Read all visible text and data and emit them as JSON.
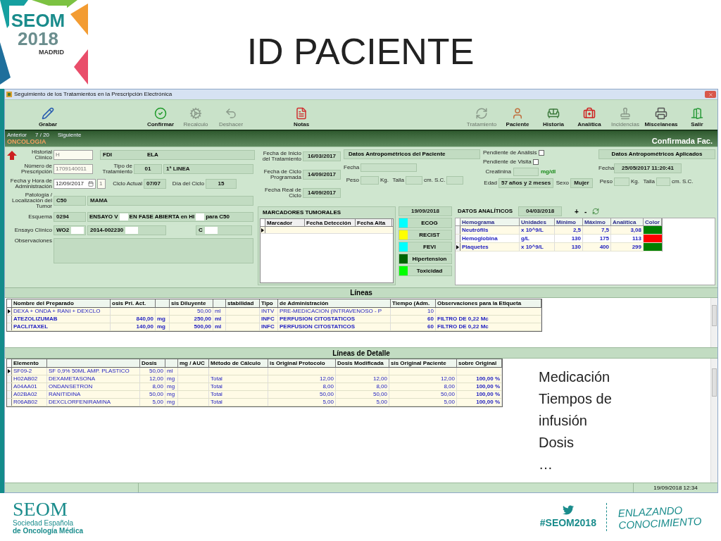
{
  "slide": {
    "logo": {
      "name": "SEOM",
      "year": "2018",
      "city": "MADRID"
    },
    "title": "ID PACIENTE",
    "notes": [
      "Medicación",
      "Tiempos de infusión",
      "Dosis",
      "…"
    ],
    "footer": {
      "org": "SEOM",
      "org_lines": [
        "Sociedad Española",
        "de Oncología Médica"
      ],
      "hashtag": "#SEOM2018",
      "slogan": [
        "ENLAZANDO",
        "CONOCIMIENTO"
      ]
    }
  },
  "window": {
    "title": "Seguimiento de los Tratamientos en la Prescripción Electrónica"
  },
  "toolbar": {
    "left_groups": [
      [
        {
          "label": "Grabar",
          "disabled": false
        }
      ],
      [
        {
          "label": "Confirmar",
          "disabled": false
        },
        {
          "label": "Recalculo",
          "disabled": true
        },
        {
          "label": "Deshacer",
          "disabled": true
        }
      ],
      [
        {
          "label": "Notas",
          "disabled": false
        }
      ]
    ],
    "right": [
      {
        "label": "Tratamiento",
        "disabled": true
      },
      {
        "label": "Paciente",
        "disabled": false
      },
      {
        "label": "Historia",
        "disabled": false
      },
      {
        "label": "Analítica",
        "disabled": false
      },
      {
        "label": "Incidencias",
        "disabled": true
      },
      {
        "label": "Miscelaneas",
        "disabled": false
      },
      {
        "label": "Salir",
        "disabled": false
      }
    ]
  },
  "navigation": {
    "previous": "Anterior",
    "position": "7 / 20",
    "next": "Siguiente",
    "department": "ONCOLOGIA",
    "status": "Confirmada Fac."
  },
  "patient": {
    "historial_clinico": {
      "label": "Historial Clínico",
      "value": "H"
    },
    "numero_prescripcion": {
      "label": "Número de Prescripción",
      "value": "1709140011"
    },
    "fecha_administracion": {
      "label": "Fecha y Hora de Administración",
      "value": "12/09/2017",
      "hour": "1"
    },
    "diagnosis": [
      "FDI",
      "ELA"
    ],
    "tipo_tratamiento": {
      "label": "Tipo de Tratamiento",
      "code": "01",
      "value": "1ª LINEA"
    },
    "ciclo_actual": {
      "label": "Ciclo Actual",
      "value": "07/07"
    },
    "dia_ciclo": {
      "label": "Día del Ciclo",
      "value": "15"
    },
    "patologia": {
      "label": "Patología / Localización del Tumor",
      "code": "C50",
      "value": "MAMA"
    },
    "esquema": {
      "label": "Esquema",
      "code": "0294",
      "parts": [
        "ENSAYO V",
        "EN FASE ABIERTA en HI",
        "para C50"
      ]
    },
    "ensayo": {
      "label": "Ensayo Clínico",
      "values": [
        "WO2",
        "2014-002230",
        "C"
      ]
    },
    "observaciones": {
      "label": "Observaciones"
    }
  },
  "treatment_dates": [
    {
      "label": "Fecha de Inicio del Tratamiento",
      "value": "16/03/2017"
    },
    {
      "label": "Fecha de Ciclo Programada",
      "value": "14/09/2017"
    },
    {
      "label": "Fecha Real de Ciclo",
      "value": "14/09/2017"
    }
  ],
  "antro_paciente": {
    "title": "Datos Antropométricos del Paciente",
    "fecha": "Fecha",
    "peso": "Peso",
    "kg": "Kg.",
    "talla": "Talla",
    "cm": "cm.",
    "sc": "S.C."
  },
  "pendientes": [
    {
      "label": "Pendiente de Análisis",
      "checked": false
    },
    {
      "label": "Pendiente de Visita",
      "checked": false
    }
  ],
  "creatinina": {
    "label": "Creatinina",
    "unit": "mg/dl"
  },
  "edad": {
    "label": "Edad",
    "value": "57 años y 2 meses"
  },
  "sexo": {
    "label": "Sexo",
    "value": "Mujer"
  },
  "antro_aplicados": {
    "title": "Datos Antropométricos Aplicados",
    "fecha_label": "Fecha",
    "fecha": "25/05/2017 11:20:41",
    "peso": "Peso",
    "kg": "Kg.",
    "talla": "Talla",
    "cm": "cm.",
    "sc": "S.C."
  },
  "marcadores": {
    "title": "MARCADORES TUMORALES",
    "columns": [
      "Marcador",
      "Fecha Detección",
      "Fecha Alta"
    ]
  },
  "evaluaciones": {
    "date": "19/09/2018",
    "items": [
      {
        "label": "ECOG",
        "color": "#00ffff"
      },
      {
        "label": "RECIST",
        "color": "#ffff00"
      },
      {
        "label": "FEVI",
        "color": "#00ffff"
      },
      {
        "label": "Hipertension",
        "color": "#006400"
      },
      {
        "label": "Toxicidad",
        "color": "#00ff00"
      }
    ]
  },
  "analiticos": {
    "title": "DATOS ANALÍTICOS",
    "date": "04/03/2018",
    "add": "+",
    "remove": "-",
    "columns": [
      "Hemograma",
      "Unidades",
      "Mínimo",
      "Máximo",
      "Analítica",
      "Color"
    ],
    "rows": [
      {
        "cells": [
          "Neutrófils",
          "x 10^9/L",
          "2,5",
          "7,5",
          "3,08"
        ],
        "color": "#008000",
        "current": false
      },
      {
        "cells": [
          "Hemoglobina",
          "g/L",
          "130",
          "175",
          "113"
        ],
        "color": "#ff0000",
        "current": false
      },
      {
        "cells": [
          "Plaquetes",
          "x 10^9/L",
          "130",
          "400",
          "299"
        ],
        "color": "#008000",
        "current": true
      }
    ]
  },
  "lineas": {
    "title": "Líneas",
    "columns": [
      "Nombre del Preparado",
      "osis Pri. Act.",
      null,
      "sis Diluyente",
      null,
      "stabilidad",
      "Tipo",
      "de Administración",
      "Tiempo (Adm.",
      "Observaciones para la Etiqueta"
    ],
    "rows": [
      {
        "cells": [
          "DEXA + ONDA + RANI + DEXCLO",
          null,
          null,
          "50,00",
          "ml",
          null,
          "INTV",
          "PRE-MEDICACION  (INTRAVENOSO - P",
          "10",
          null
        ],
        "emphasized": false,
        "current": true
      },
      {
        "cells": [
          "ATEZOLIZUMAB",
          "840,00",
          "mg",
          "250,00",
          "ml",
          null,
          "INFC",
          "PERFUSION CITOSTATICOS",
          "60",
          "FILTRO DE 0,22 Mc"
        ],
        "emphasized": true,
        "current": false
      },
      {
        "cells": [
          "PACLITAXEL",
          "140,00",
          "mg",
          "500,00",
          "ml",
          null,
          "INFC",
          "PERFUSION CITOSTATICOS",
          "60",
          "FILTRO DE 0,22 Mc"
        ],
        "emphasized": true,
        "current": false
      }
    ]
  },
  "detalle": {
    "title": "Líneas de Detalle",
    "columns": [
      "Elemento",
      null,
      "Dosis",
      null,
      "mg / AUC",
      "Método de Cálculo",
      "is Original Protocolo",
      "Dosis Modificada",
      "sis Original Paciente",
      "sobre Original"
    ],
    "rows": [
      {
        "cells": [
          "SF09-2",
          "SF 0,9% 50ML AMP. PLASTICO",
          "50,00",
          "ml",
          null,
          null,
          null,
          null,
          null,
          null
        ],
        "current": true
      },
      {
        "cells": [
          "H02AB02",
          "DEXAMETASONA",
          "12,00",
          "mg",
          null,
          "Total",
          "12,00",
          "12,00",
          "12,00",
          "100,00 %"
        ],
        "current": false
      },
      {
        "cells": [
          "A04AA01",
          "ONDANSETRON",
          "8,00",
          "mg",
          null,
          "Total",
          "8,00",
          "8,00",
          "8,00",
          "100,00 %"
        ],
        "current": false
      },
      {
        "cells": [
          "A02BA02",
          "RANITIDINA",
          "50,00",
          "mg",
          null,
          "Total",
          "50,00",
          "50,00",
          "50,00",
          "100,00 %"
        ],
        "current": false
      },
      {
        "cells": [
          "R06AB02",
          "DEXCLORFENIRAMINA",
          "5,00",
          "mg",
          null,
          "Total",
          "5,00",
          "5,00",
          "5,00",
          "100,00 %"
        ],
        "current": false
      }
    ]
  },
  "status_bar": {
    "datetime": "19/09/2018 12:34"
  }
}
